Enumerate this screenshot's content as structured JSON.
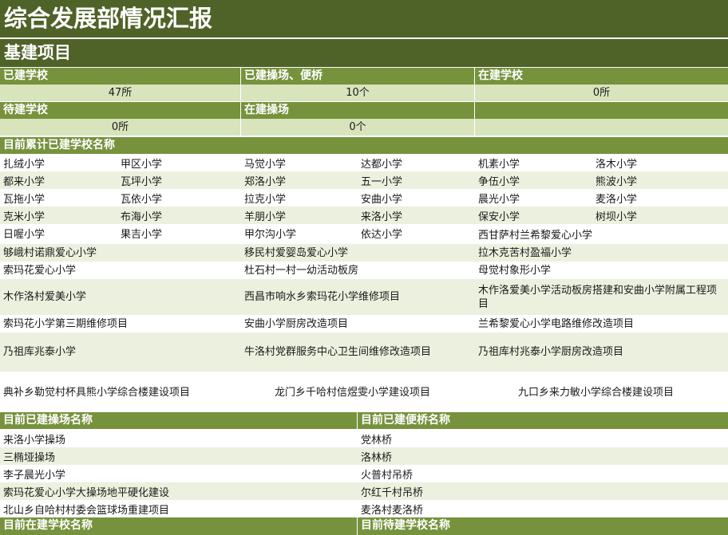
{
  "title": "综合发展部情况汇报",
  "section": "基建项目",
  "stats": {
    "built_schools_label": "已建学校",
    "built_schools_value": "47所",
    "built_fields_label": "已建操场、便桥",
    "built_fields_value": "10个",
    "building_schools_label": "在建学校",
    "building_schools_value": "0所",
    "pending_schools_label": "待建学校",
    "pending_schools_value": "0所",
    "building_fields_label": "在建操场",
    "building_fields_value": "0个"
  },
  "school_list_header": "目前累计已建学校名称",
  "school_grid": [
    [
      "扎绒小学",
      "甲区小学",
      "马觉小学",
      "达都小学",
      "机素小学",
      "洛木小学"
    ],
    [
      "都来小学",
      "瓦坪小学",
      "郑洛小学",
      "五一小学",
      "争伍小学",
      "熊波小学"
    ],
    [
      "瓦拖小学",
      "瓦依小学",
      "拉克小学",
      "安曲小学",
      "晨光小学",
      "麦洛小学"
    ],
    [
      "克米小学",
      "布海小学",
      "羊朋小学",
      "来洛小学",
      "保安小学",
      "树坝小学"
    ],
    [
      "日喔小学",
      "果吉小学",
      "甲尔沟小学",
      "依达小学",
      "西甘萨村兰希黎爱心小学",
      ""
    ]
  ],
  "school_rows3": [
    [
      "够峨村诺鼎爱心小学",
      "移民村爱婴岛爱心小学",
      "拉木克苦村盈福小学"
    ],
    [
      "索玛花爱心小学",
      "杜石村一村一幼活动板房",
      "母觉村象形小学"
    ],
    [
      "木作洛村爱美小学",
      "西昌市响水乡索玛花小学维修项目",
      "木作洛爱美小学活动板房搭建和安曲小学附属工程项目"
    ],
    [
      "索玛花小学第三期维修项目",
      "安曲小学厨房改造项目",
      "兰希黎爱心小学电路维修改造项目"
    ],
    [
      "乃祖库兆泰小学",
      "牛洛村党群服务中心卫生间维修改造项目",
      "乃祖库村兆泰小学厨房改造项目"
    ]
  ],
  "plain_row": [
    "典补乡勒觉村杯具熊小学综合楼建设项目",
    "龙门乡千哈村信煜雯小学建设项目",
    "九口乡来力敏小学综合楼建设项目"
  ],
  "fields_header": "目前已建操场名称",
  "bridges_header": "目前已建便桥名称",
  "fields": [
    "来洛小学操场",
    "三椭垭操场",
    "李子晨光小学",
    "索玛花爱心小学大操场地平硬化建设",
    "北山乡自哈村村委会篮球场重建项目"
  ],
  "bridges": [
    "党林桥",
    "洛林桥",
    "火普村吊桥",
    "尔红千村吊桥",
    "麦洛村麦洛桥"
  ],
  "building_schools_header": "目前在建学校名称",
  "pending_schools_header": "目前待建学校名称",
  "colors": {
    "dark_green": "#4f6228",
    "mid_green": "#76923c",
    "light_green": "#d7e4bc",
    "pale_green": "#ebf1de"
  }
}
